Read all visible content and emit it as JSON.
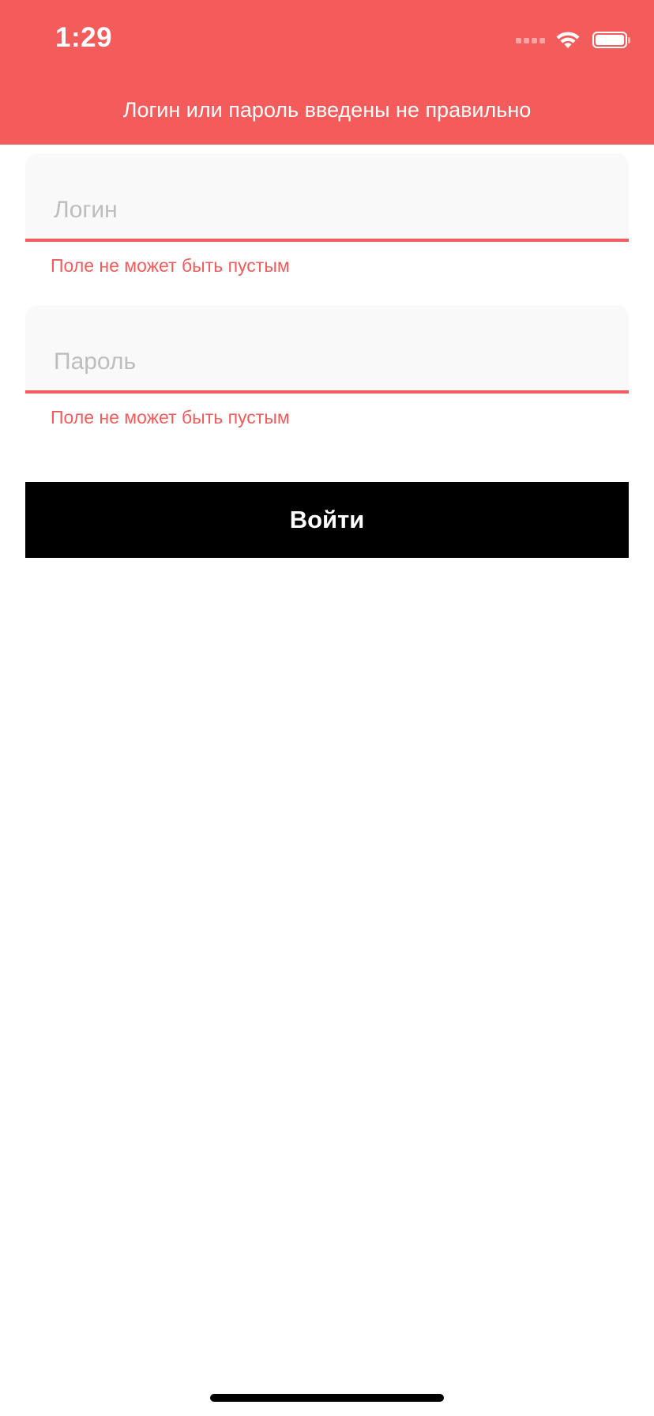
{
  "status_bar": {
    "time": "1:29",
    "icons": [
      "cellular-signal-icon",
      "wifi-icon",
      "battery-icon"
    ]
  },
  "banner": {
    "message": "Логин или пароль введены не правильно",
    "color": "#f45b5b"
  },
  "form": {
    "login": {
      "value": "",
      "placeholder": "Логин",
      "error": "Поле не может быть пустым"
    },
    "password": {
      "value": "",
      "placeholder": "Пароль",
      "error": "Поле не может быть пустым"
    },
    "submit_label": "Войти"
  },
  "colors": {
    "accent": "#f45b5b",
    "button": "#000000",
    "field_background": "#f9f9f9"
  }
}
